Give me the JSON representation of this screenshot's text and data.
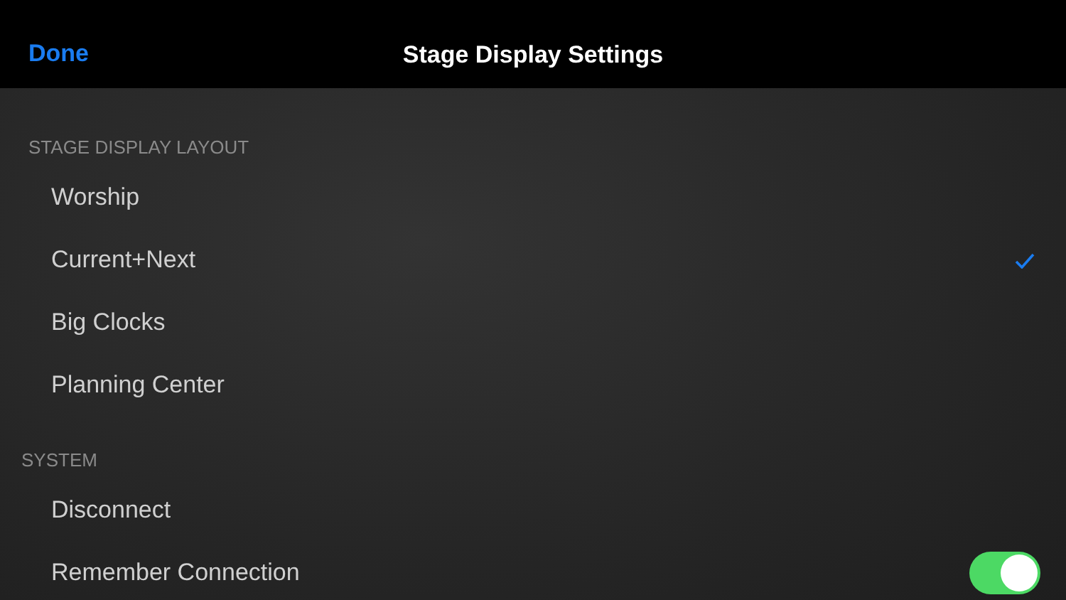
{
  "nav_bar": {
    "done_button": "Done",
    "title": "Stage Display Settings"
  },
  "sections": [
    {
      "header": "STAGE DISPLAY LAYOUT",
      "items": [
        {
          "label": "Worship",
          "kind": "choice",
          "selected": false
        },
        {
          "label": "Current+Next",
          "kind": "choice",
          "selected": true
        },
        {
          "label": "Big Clocks",
          "kind": "choice",
          "selected": false
        },
        {
          "label": "Planning Center",
          "kind": "choice",
          "selected": false
        }
      ]
    },
    {
      "header": "SYSTEM",
      "items": [
        {
          "label": "Disconnect",
          "kind": "action"
        },
        {
          "label": "Remember Connection",
          "kind": "toggle",
          "on": true
        }
      ]
    }
  ]
}
